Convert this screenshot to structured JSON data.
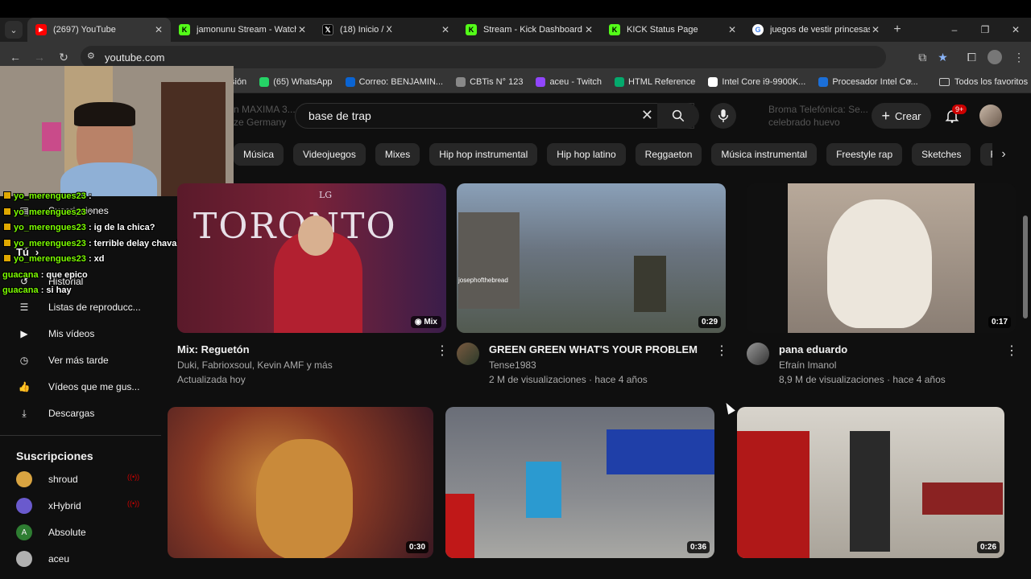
{
  "browser": {
    "tabs": [
      {
        "title": "(2697) YouTube",
        "favicon": "youtube-icon",
        "active": true,
        "color": "#ff0000"
      },
      {
        "title": "jamonunu Stream - Watch",
        "favicon": "kick-icon",
        "active": false,
        "color": "#53fc18"
      },
      {
        "title": "(18) Inicio / X",
        "favicon": "x-icon",
        "active": false,
        "color": "#000000"
      },
      {
        "title": "Stream - Kick Dashboard",
        "favicon": "kick-icon",
        "active": false,
        "color": "#53fc18"
      },
      {
        "title": "KICK Status Page",
        "favicon": "kick-icon",
        "active": false,
        "color": "#53fc18"
      },
      {
        "title": "juegos de vestir princesas",
        "favicon": "google-icon",
        "active": false,
        "color": "#4285f4"
      }
    ],
    "url": "youtube.com",
    "bookmarks": [
      {
        "label": "sión",
        "icon": "bookmark-icon",
        "color": ""
      },
      {
        "label": "(65) WhatsApp",
        "icon": "whatsapp-icon",
        "color": "#25d366"
      },
      {
        "label": "Correo: BENJAMIN...",
        "icon": "outlook-icon",
        "color": "#0a64d3"
      },
      {
        "label": "CBTis N° 123",
        "icon": "globe-icon",
        "color": "#888888"
      },
      {
        "label": "aceu - Twitch",
        "icon": "twitch-icon",
        "color": "#9146ff"
      },
      {
        "label": "HTML Reference",
        "icon": "w3-icon",
        "color": "#04aa6d"
      },
      {
        "label": "Intel Core i9-9900K...",
        "icon": "amazon-icon",
        "color": "#ffffff"
      },
      {
        "label": "Procesador Intel Co...",
        "icon": "store-icon",
        "color": "#1b6fd8"
      }
    ],
    "all_bookmarks_label": "Todos los favoritos"
  },
  "youtube": {
    "search_value": "base de trap",
    "create_label": "Crear",
    "notifications_badge": "9+",
    "ghost_left": "n MAXIMA 3... ze Germany",
    "ghost_right": "Broma Telefónica: Se... celebrado huevo",
    "chips": [
      "Música",
      "Videojuegos",
      "Mixes",
      "Hip hop instrumental",
      "Hip hop latino",
      "Reggaeton",
      "Música instrumental",
      "Freestyle rap",
      "Sketches",
      "Rock alternativo"
    ],
    "sidebar": {
      "partial_items": [
        "Suscripciones",
        "Tú",
        "Historial"
      ],
      "items": [
        {
          "label": "Listas de reproducc...",
          "icon": "playlist-icon"
        },
        {
          "label": "Mis vídeos",
          "icon": "my-videos-icon"
        },
        {
          "label": "Ver más tarde",
          "icon": "clock-icon"
        },
        {
          "label": "Vídeos que me gus...",
          "icon": "thumbs-up-icon"
        },
        {
          "label": "Descargas",
          "icon": "download-icon"
        }
      ],
      "subs_heading": "Suscripciones",
      "channels": [
        {
          "name": "shroud",
          "live": true,
          "color": "#d9a441",
          "initial": ""
        },
        {
          "name": "xHybrid",
          "live": true,
          "color": "#6a5acd",
          "initial": ""
        },
        {
          "name": "Absolute",
          "live": false,
          "color": "#2e7d32",
          "initial": "A"
        },
        {
          "name": "aceu",
          "live": false,
          "color": "#b0b0b0",
          "initial": ""
        }
      ]
    },
    "videos_row1": [
      {
        "title": "Mix: Reguetón",
        "meta1": "Duki, Fabrioxsoul, Kevin AMF y más",
        "meta2": "Actualizada hoy",
        "badge": "Mix",
        "thumb_text": "TORONTO",
        "thumb_small": "LG"
      },
      {
        "title": "GREEN GREEN WHAT'S YOUR PROBLEM",
        "meta1": "Tense1983",
        "meta2": "2 M de visualizaciones · hace 4 años",
        "badge": "0:29",
        "thumb_text": "josephofthebread"
      },
      {
        "title": "pana eduardo",
        "meta1": "Efraín Imanol",
        "meta2": "8,9 M de visualizaciones · hace 4 años",
        "badge": "0:17"
      }
    ],
    "videos_row2": [
      {
        "badge": "0:30"
      },
      {
        "badge": "0:36"
      },
      {
        "badge": "0:26"
      }
    ]
  },
  "stream_chat": [
    {
      "user": "yo_merengues23",
      "msg": ":"
    },
    {
      "user": "yo_merengues23",
      "msg": ":"
    },
    {
      "user": "yo_merengues23",
      "msg": ": ig de la chica?"
    },
    {
      "user": "yo_merengues23",
      "msg": ": terrible delay chavalin"
    },
    {
      "user": "yo_merengues23",
      "msg": ": xd"
    },
    {
      "user": "guacana",
      "msg": ": que epico"
    },
    {
      "user": "guacana",
      "msg": ": si hay"
    }
  ]
}
